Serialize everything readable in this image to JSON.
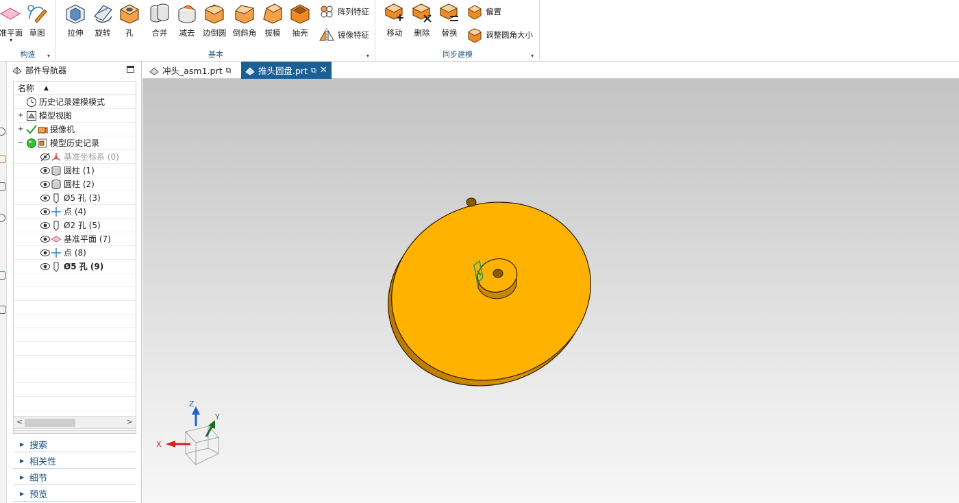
{
  "ribbon": {
    "construct": {
      "tools": [
        "准平面",
        "草图"
      ],
      "label": "构造"
    },
    "basic": {
      "tools": [
        "拉伸",
        "旋转",
        "孔",
        "合并",
        "减去",
        "边倒圆",
        "倒斜角",
        "拔模",
        "抽壳"
      ],
      "side_tools": [
        "阵列特征",
        "镜像特征"
      ],
      "label": "基本"
    },
    "sync": {
      "tools": [
        "移动",
        "删除",
        "替换"
      ],
      "side_tools": [
        "偏置",
        "调整圆角大小"
      ],
      "label": "同步建模"
    }
  },
  "navigator": {
    "title": "部件导航器",
    "column_header": "名称",
    "items": [
      {
        "label": "历史记录建模模式",
        "icon": "clock-icon"
      },
      {
        "label": "模型视图",
        "icon": "model-view-icon"
      },
      {
        "label": "摄像机",
        "icon": "camera-icon"
      },
      {
        "label": "模型历史记录",
        "icon": "model-history-icon"
      },
      {
        "label": "基准坐标系 (0)",
        "icon": "datum-csys-icon"
      },
      {
        "label": "圆柱 (1)",
        "icon": "cylinder-icon"
      },
      {
        "label": "圆柱 (2)",
        "icon": "cylinder-icon"
      },
      {
        "label": "Ø5 孔 (3)",
        "icon": "hole-icon"
      },
      {
        "label": "点 (4)",
        "icon": "point-icon"
      },
      {
        "label": "Ø2 孔 (5)",
        "icon": "hole-icon"
      },
      {
        "label": "基准平面 (7)",
        "icon": "datum-plane-icon"
      },
      {
        "label": "点 (8)",
        "icon": "point-icon"
      },
      {
        "label": "Ø5 孔 (9)",
        "icon": "hole-icon"
      }
    ],
    "sections": [
      "搜索",
      "相关性",
      "细节",
      "预览"
    ]
  },
  "tabs": [
    {
      "label": "冲头_asm1.prt",
      "active": false
    },
    {
      "label": "推头圆盘.prt",
      "active": true
    }
  ],
  "triad": {
    "x": "X",
    "y": "Y",
    "z": "Z"
  },
  "colors": {
    "part": "#FFB300",
    "active_tab": "#1B5F97",
    "section_text": "#1C4F86",
    "ribbon_orange": "#F08A24"
  }
}
